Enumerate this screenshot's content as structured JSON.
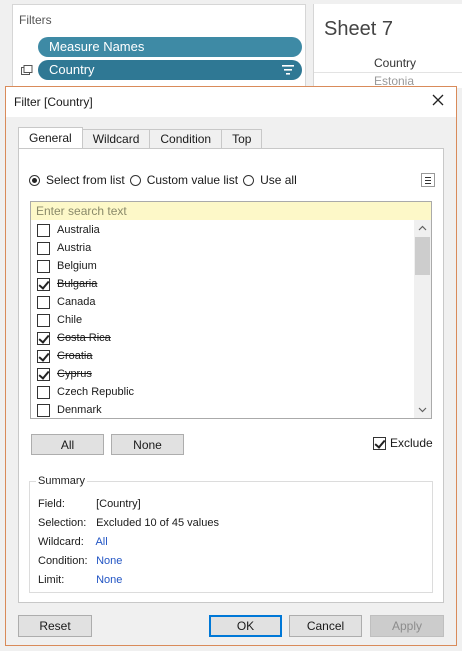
{
  "background": {
    "filters_title": "Filters",
    "pills": [
      {
        "label": "Measure Names"
      },
      {
        "label": "Country"
      }
    ],
    "sheet_title": "Sheet 7",
    "column_header": "Country",
    "row_header": "Estonia"
  },
  "dialog": {
    "title": "Filter [Country]",
    "tabs": [
      {
        "label": "General",
        "active": true
      },
      {
        "label": "Wildcard"
      },
      {
        "label": "Condition"
      },
      {
        "label": "Top"
      }
    ],
    "radio": {
      "select_from_list": "Select from list",
      "custom_value_list": "Custom value list",
      "use_all": "Use all"
    },
    "search_placeholder": "Enter search text",
    "items": [
      {
        "label": "Australia",
        "checked": false
      },
      {
        "label": "Austria",
        "checked": false
      },
      {
        "label": "Belgium",
        "checked": false
      },
      {
        "label": "Bulgaria",
        "checked": true
      },
      {
        "label": "Canada",
        "checked": false
      },
      {
        "label": "Chile",
        "checked": false
      },
      {
        "label": "Costa Rica",
        "checked": true
      },
      {
        "label": "Croatia",
        "checked": true
      },
      {
        "label": "Cyprus",
        "checked": true
      },
      {
        "label": "Czech Republic",
        "checked": false
      },
      {
        "label": "Denmark",
        "checked": false
      }
    ],
    "all_label": "All",
    "none_label": "None",
    "exclude_label": "Exclude",
    "summary": {
      "title": "Summary",
      "field_label": "Field:",
      "field_value": "[Country]",
      "selection_label": "Selection:",
      "selection_value": "Excluded 10 of 45 values",
      "wildcard_label": "Wildcard:",
      "wildcard_value": "All",
      "condition_label": "Condition:",
      "condition_value": "None",
      "limit_label": "Limit:",
      "limit_value": "None"
    },
    "reset_label": "Reset",
    "ok_label": "OK",
    "cancel_label": "Cancel",
    "apply_label": "Apply"
  }
}
